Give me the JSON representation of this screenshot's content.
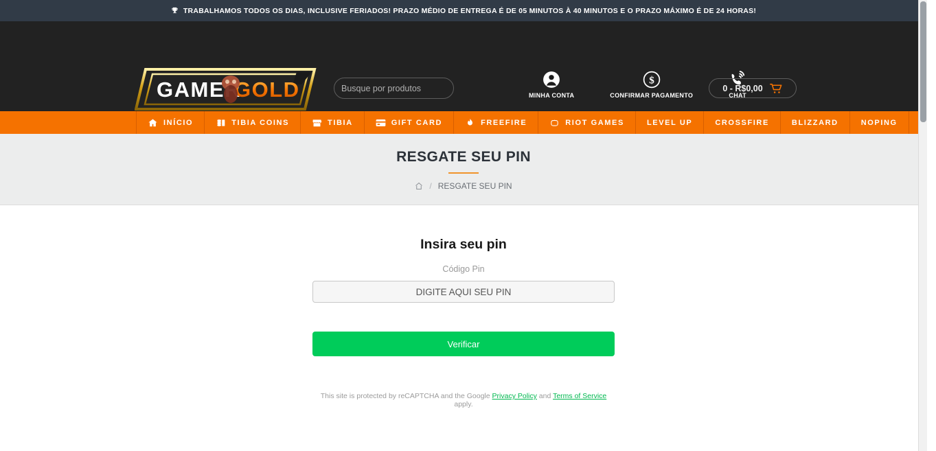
{
  "topbar": {
    "icon": "trophy-icon",
    "text": "TRABALHAMOS TODOS OS DIAS, INCLUSIVE FERIADOS! PRAZO MÉDIO DE ENTREGA É DE 05 MINUTOS À 40 MINUTOS E O PRAZO MÁXIMO É DE 24 HORAS!",
    "background": "#313b47"
  },
  "header": {
    "logo": {
      "text_primary": "GAMER",
      "text_accent": "GOLD",
      "accent_color": "#f57200"
    },
    "search": {
      "placeholder": "Busque por produtos",
      "value": "",
      "icon": "search-icon"
    },
    "actions": [
      {
        "label": "MINHA CONTA",
        "icon": "user-circle-icon"
      },
      {
        "label": "CONFIRMAR PAGAMENTO",
        "icon": "dollar-circle-icon"
      },
      {
        "label": "CHAT",
        "icon": "phone-ring-icon"
      }
    ],
    "cart": {
      "label": "0 - R$0,00",
      "icon": "cart-icon"
    },
    "background": "#222222"
  },
  "nav": {
    "background": "#f57200",
    "items": [
      {
        "label": "INÍCIO",
        "icon": "home-icon"
      },
      {
        "label": "TIBIA COINS",
        "icon": "coins-icon"
      },
      {
        "label": "TIBIA",
        "icon": "store-icon"
      },
      {
        "label": "GIFT CARD",
        "icon": "credit-card-icon"
      },
      {
        "label": "FREEFIRE",
        "icon": "flame-icon"
      },
      {
        "label": "RIOT GAMES",
        "icon": "fist-icon"
      },
      {
        "label": "LEVEL UP",
        "icon": ""
      },
      {
        "label": "CROSSFIRE",
        "icon": ""
      },
      {
        "label": "BLIZZARD",
        "icon": ""
      },
      {
        "label": "NOPING",
        "icon": ""
      }
    ]
  },
  "title_band": {
    "title": "RESGATE SEU PIN",
    "rule_color": "#f0932b",
    "breadcrumb": {
      "home_icon": "home-outline-icon",
      "separator": "/",
      "current": "RESGATE SEU PIN"
    }
  },
  "main": {
    "heading": "Insira seu pin",
    "field_label": "Código Pin",
    "pin_input": {
      "placeholder": "DIGITE AQUI SEU PIN",
      "value": ""
    },
    "verify_button": {
      "label": "Verificar",
      "color": "#00cc5a"
    },
    "recaptcha": {
      "prefix": "This site is protected by reCAPTCHA and the Google ",
      "privacy_link": "Privacy Policy",
      "middle": " and ",
      "terms_link": "Terms of Service",
      "suffix": " apply.",
      "link_color": "#00b84f"
    }
  }
}
